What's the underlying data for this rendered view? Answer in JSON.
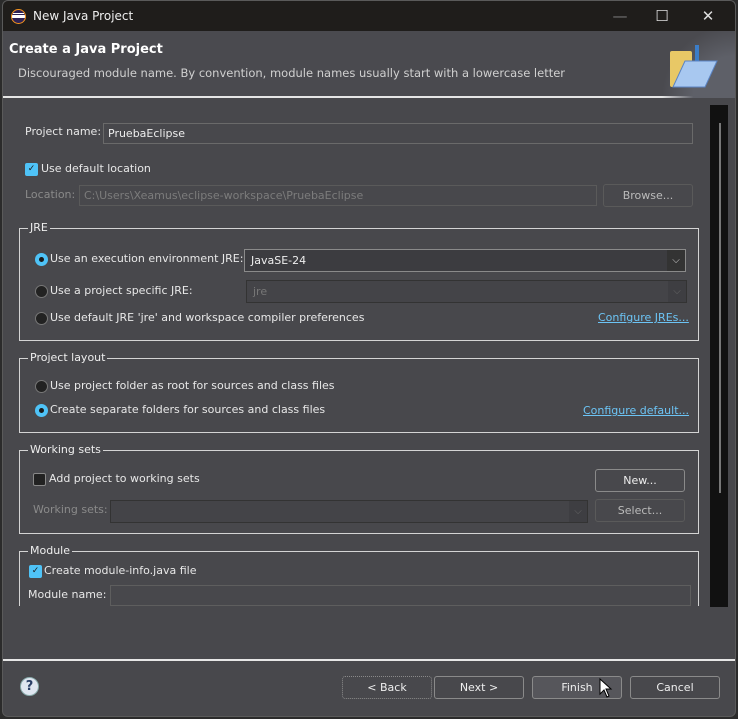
{
  "window": {
    "title": "New Java Project",
    "minimize": "—",
    "maximize": "☐",
    "close": "✕"
  },
  "header": {
    "title": "Create a Java Project",
    "message": "Discouraged module name. By convention, module names usually start with a lowercase letter",
    "icon": "new-java-project-folder-icon"
  },
  "project": {
    "name_label": "Project name:",
    "name_value": "PruebaEclipse",
    "use_default_location_label": "Use default location",
    "use_default_location": true,
    "location_label": "Location:",
    "location_value": "C:\\Users\\Xeamus\\eclipse-workspace\\PruebaEclipse",
    "browse": "Browse..."
  },
  "jre": {
    "title": "JRE",
    "opt_env": "Use an execution environment JRE:",
    "env_value": "JavaSE-24",
    "opt_specific": "Use a project specific JRE:",
    "specific_value": "jre",
    "opt_default": "Use default JRE 'jre' and workspace compiler preferences",
    "configure": "Configure JREs...",
    "selected": "execution-environment"
  },
  "layout": {
    "title": "Project layout",
    "opt_root": "Use project folder as root for sources and class files",
    "opt_separate": "Create separate folders for sources and class files",
    "configure": "Configure default...",
    "selected": "separate"
  },
  "working_sets": {
    "title": "Working sets",
    "add_label": "Add project to working sets",
    "add_checked": false,
    "new": "New...",
    "sets_label": "Working sets:",
    "select": "Select..."
  },
  "module": {
    "title": "Module",
    "create_label": "Create module-info.java file",
    "create_checked": true,
    "name_label": "Module name:",
    "name_value": ""
  },
  "footer": {
    "help": "?",
    "back": "< Back",
    "next": "Next >",
    "finish": "Finish",
    "cancel": "Cancel"
  }
}
